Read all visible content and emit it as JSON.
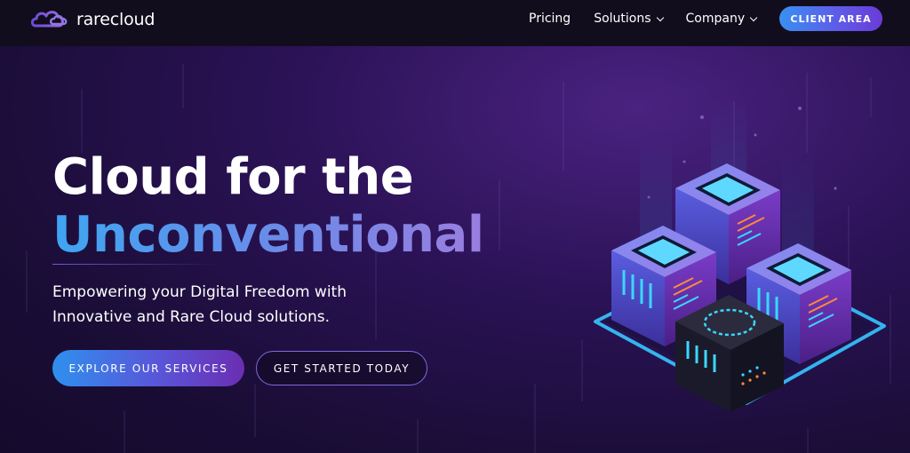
{
  "brand": {
    "name": "rarecloud"
  },
  "nav": {
    "pricing": "Pricing",
    "solutions": "Solutions",
    "company": "Company",
    "client_area": "CLIENT AREA"
  },
  "hero": {
    "headline_line1": "Cloud for the",
    "headline_line2": "Unconventional",
    "subtext_line1": "Empowering your Digital Freedom with",
    "subtext_line2": "Innovative and Rare Cloud solutions.",
    "cta_primary": "EXPLORE OUR SERVICES",
    "cta_secondary": "GET STARTED TODAY"
  },
  "colors": {
    "accent_blue": "#3a8ff0",
    "accent_purple": "#6a3bd8",
    "background": "#150c2a",
    "navbar": "#120d1c"
  },
  "icons": {
    "logo": "cloud-logo-icon",
    "dropdown": "chevron-down-icon",
    "illustration": "server-cubes-illustration"
  }
}
